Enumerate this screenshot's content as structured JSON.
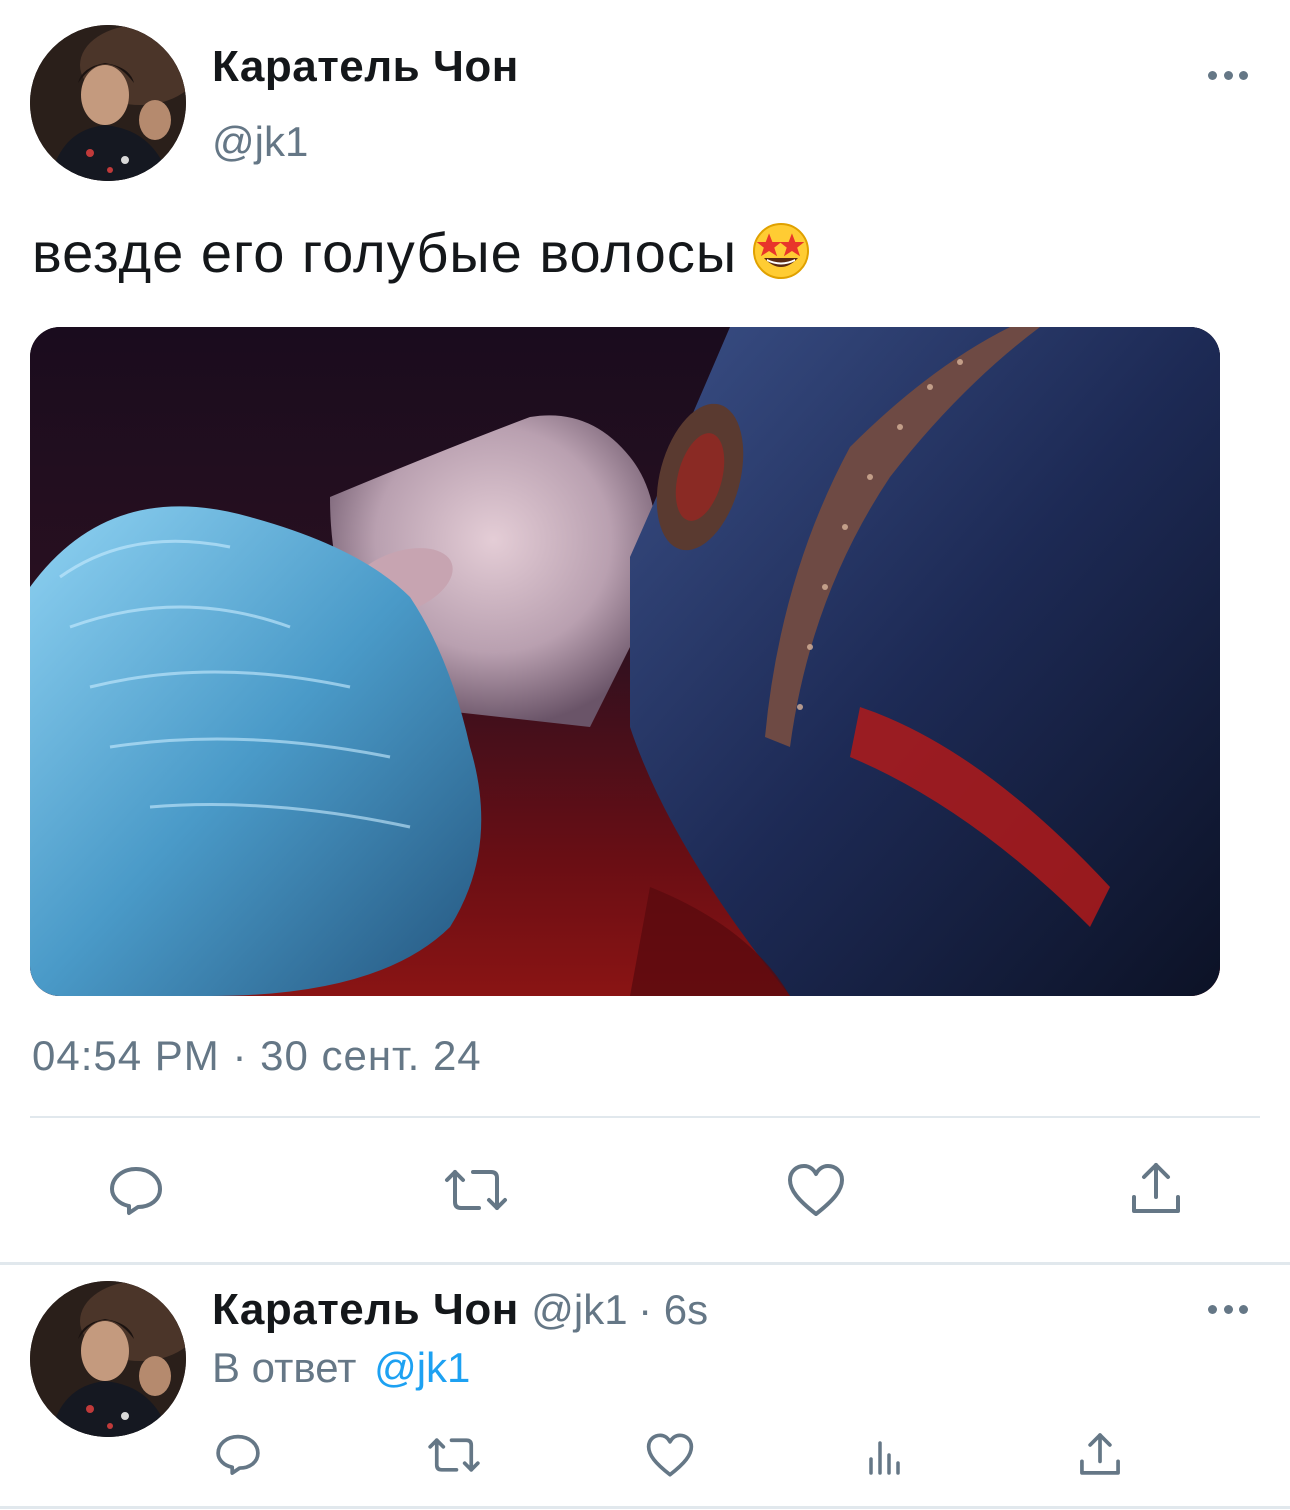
{
  "tweet": {
    "author": {
      "display_name": "Каратель Чон",
      "handle": "@jk1",
      "avatar_icon": "user-avatar"
    },
    "text": "везде его голубые волосы",
    "emoji": "star-struck",
    "timestamp": "04:54 PM · 30 сент. 24",
    "actions": [
      "reply-icon",
      "retweet-icon",
      "like-icon",
      "share-icon"
    ]
  },
  "reply": {
    "author": {
      "display_name": "Каратель Чон",
      "handle": "@jk1",
      "time_ago": "· 6s"
    },
    "reply_prefix": "В ответ",
    "reply_to": "@jk1",
    "actions": [
      "reply-icon",
      "retweet-icon",
      "like-icon",
      "analytics-icon",
      "share-icon"
    ]
  },
  "colors": {
    "text_primary": "#14171a",
    "text_secondary": "#657786",
    "link": "#1da1f2",
    "divider": "#e1e8ed"
  }
}
